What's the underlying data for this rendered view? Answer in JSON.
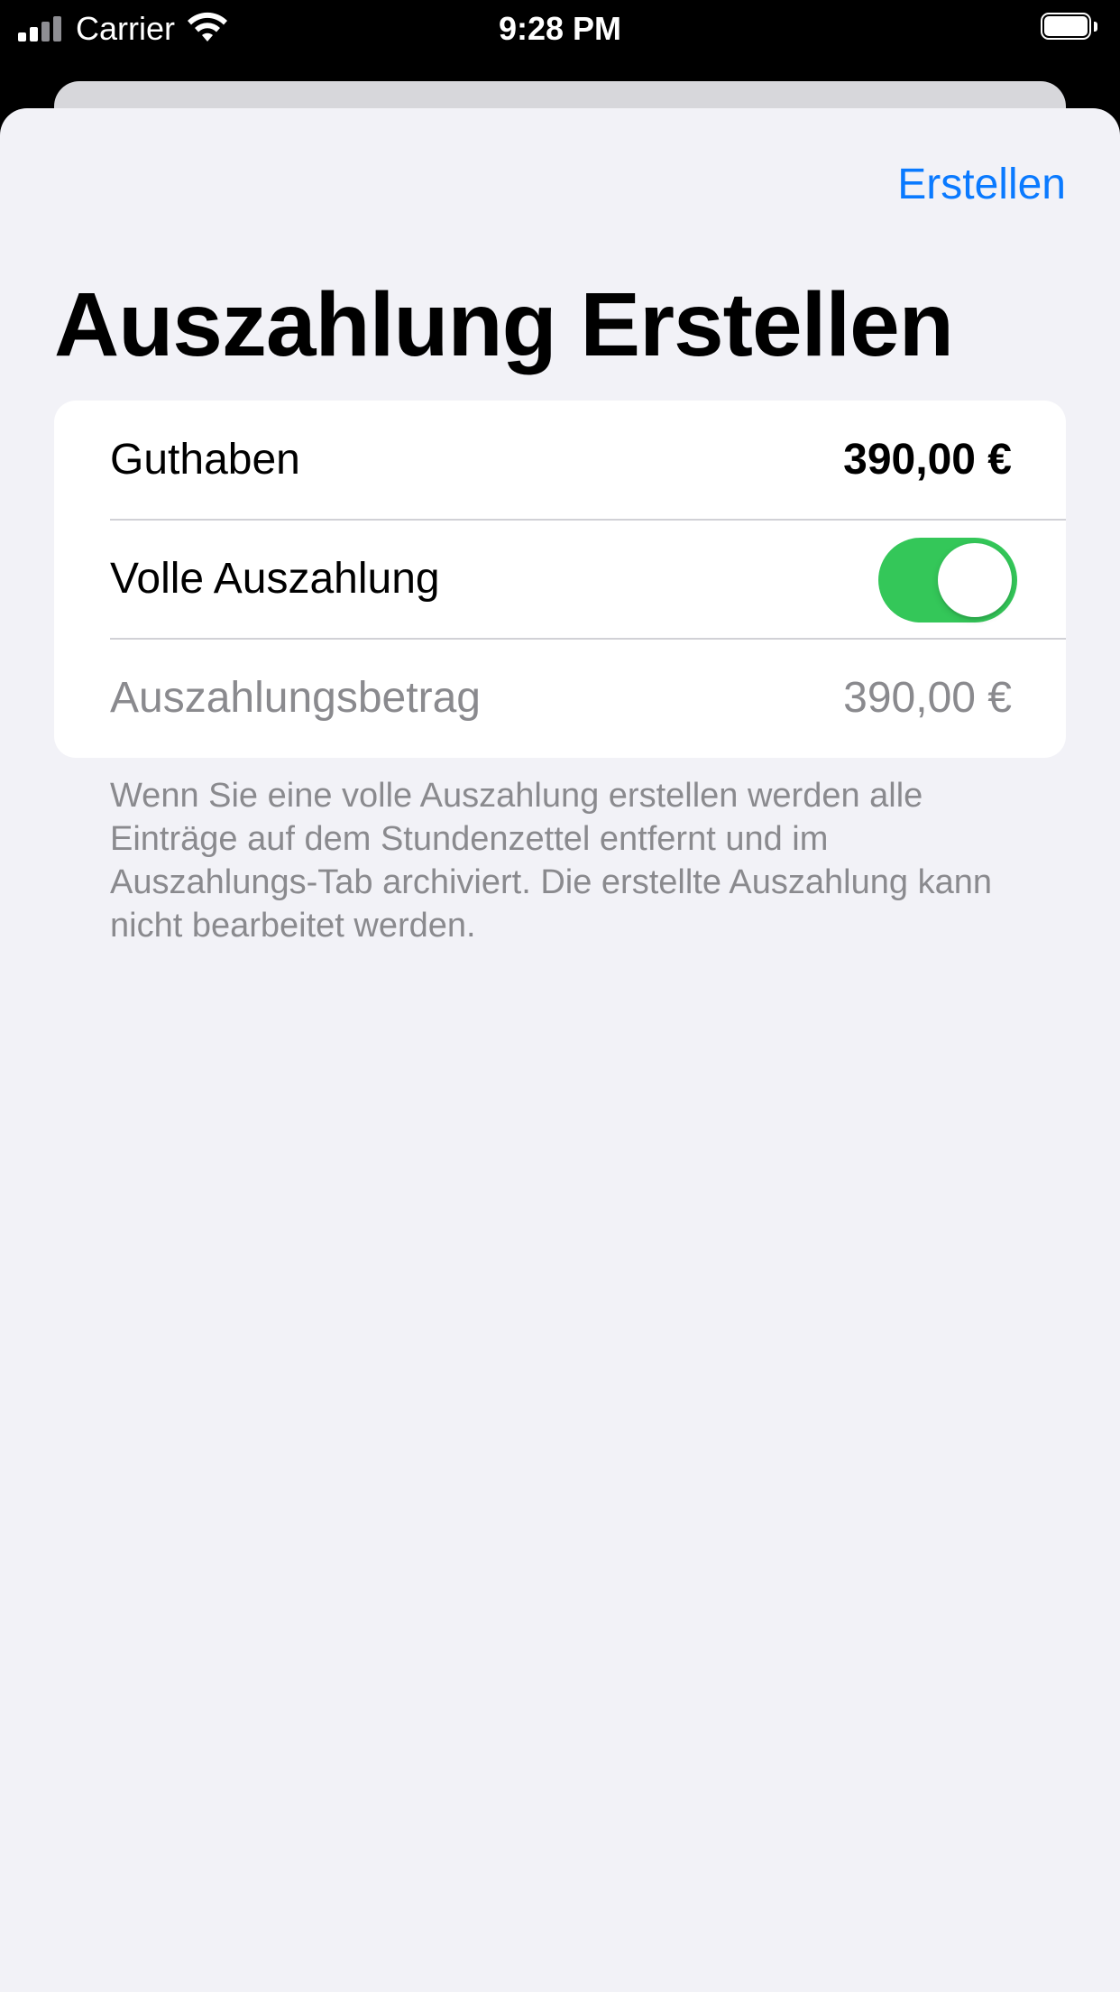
{
  "status_bar": {
    "carrier": "Carrier",
    "time": "9:28 PM",
    "signal_icon": "cellular-signal-icon",
    "wifi_icon": "wifi-icon",
    "battery_icon": "battery-icon"
  },
  "nav": {
    "action_label": "Erstellen"
  },
  "title": "Auszahlung Erstellen",
  "form": {
    "balance": {
      "label": "Guthaben",
      "value": "390,00 €"
    },
    "full_payout": {
      "label": "Volle Auszahlung",
      "toggle_on": true
    },
    "payout_amount": {
      "label": "Auszahlungsbetrag",
      "value": "390,00 €"
    }
  },
  "footer": "Wenn Sie eine volle Auszahlung erstellen werden alle Einträge auf dem Stundenzettel entfernt und im Auszahlungs-Tab archiviert. Die erstellte Auszahlung kann nicht bearbeitet werden.",
  "colors": {
    "accent": "#0a7aff",
    "toggle_on": "#34c759",
    "sheet_background": "#f2f2f7",
    "secondary_text": "#8a8a8e"
  }
}
